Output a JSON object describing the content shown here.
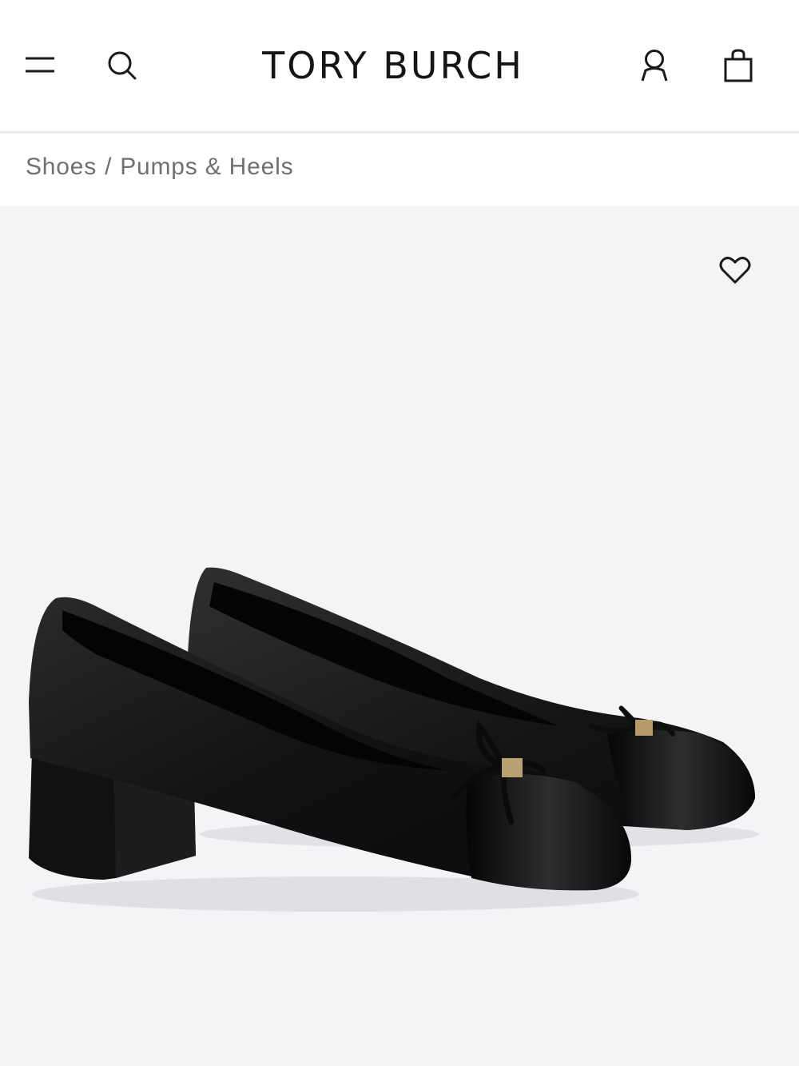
{
  "header": {
    "logo_text": "TORY BURCH",
    "icons": {
      "menu": "hamburger-menu-icon",
      "search": "search-icon",
      "account": "account-icon",
      "bag": "shopping-bag-icon"
    }
  },
  "breadcrumb": {
    "items": [
      "Shoes",
      "Pumps & Heels"
    ],
    "separator": "/"
  },
  "product": {
    "wishlist_icon": "heart-icon",
    "image_description": "Black leather cap-toe pumps with bow and gold logo",
    "colors": {
      "background": "#f4f3f6",
      "shoe": "#141414"
    }
  }
}
